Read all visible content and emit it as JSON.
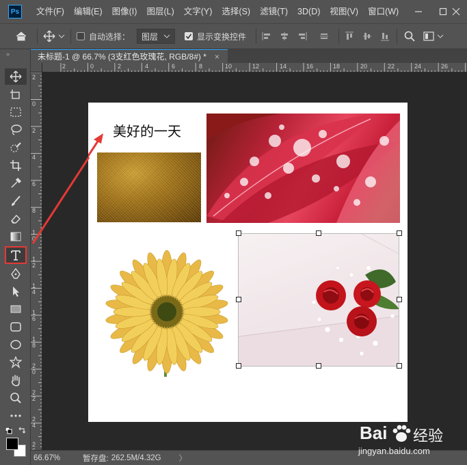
{
  "app": {
    "logo_text": "Ps"
  },
  "menu": [
    "文件(F)",
    "编辑(E)",
    "图像(I)",
    "图层(L)",
    "文字(Y)",
    "选择(S)",
    "滤镜(T)",
    "3D(D)",
    "视图(V)",
    "窗口(W)"
  ],
  "options_bar": {
    "auto_select_label": "自动选择：",
    "auto_select_checked": false,
    "layer_dropdown_value": "图层",
    "show_transform_label": "显示变换控件",
    "show_transform_checked": true
  },
  "tab": {
    "title": "未标题-1 @ 66.7% (3支红色玫瑰花, RGB/8#) *",
    "close": "×"
  },
  "ruler_top_numbers": [
    "2",
    "0",
    "2",
    "4",
    "6",
    "8",
    "10",
    "12",
    "14",
    "16",
    "18",
    "20",
    "22",
    "24",
    "26"
  ],
  "ruler_left_numbers": [
    "2",
    "0",
    "2",
    "4",
    "6",
    "8",
    "1\n0",
    "1\n2",
    "1\n4",
    "1\n6",
    "1\n8",
    "2\n0",
    "2\n2",
    "2\n4",
    "2\n6"
  ],
  "canvas": {
    "title_text": "美好的一天"
  },
  "status": {
    "zoom": "66.67%",
    "scratch_label": "暂存盘:",
    "scratch_value": "262.5M/4.32G",
    "arrow": "〉"
  },
  "watermark": {
    "brand": "Bai",
    "brand_cn": "经验",
    "url": "jingyan.baidu.com"
  },
  "colors": {
    "highlight_red": "#e53935",
    "accent_blue": "#31a8ff"
  }
}
